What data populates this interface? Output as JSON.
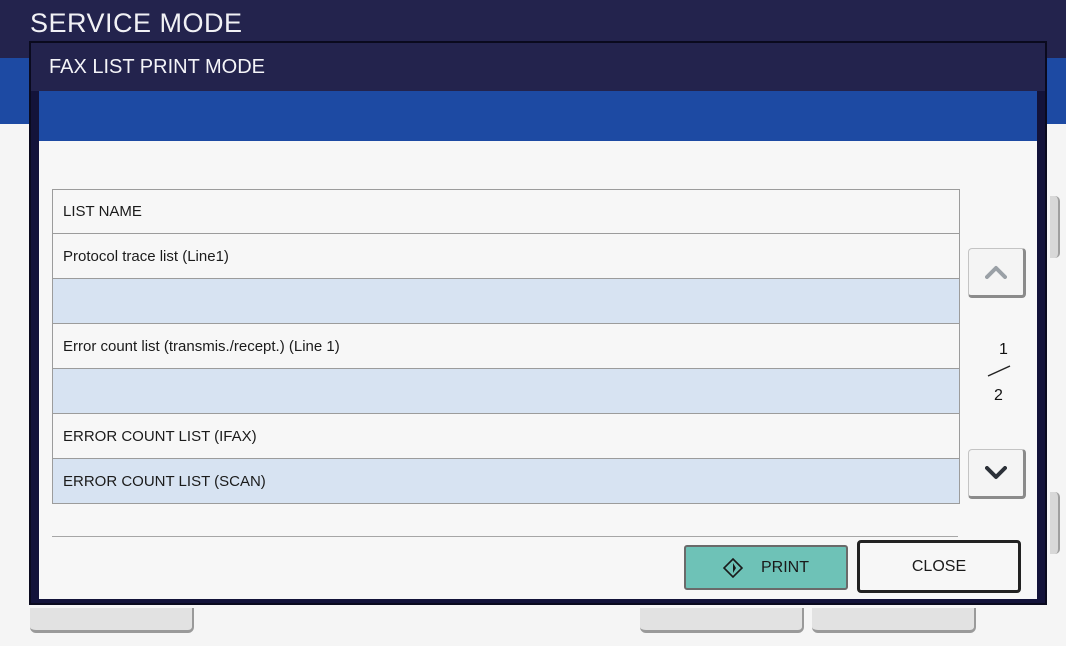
{
  "background": {
    "title": "SERVICE MODE"
  },
  "dialog": {
    "title": "FAX LIST PRINT MODE",
    "table": {
      "header": "LIST NAME",
      "rows": [
        "Protocol trace list (Line1)",
        "",
        "Error count list (transmis./recept.) (Line 1)",
        "",
        "ERROR COUNT LIST (IFAX)",
        "ERROR COUNT LIST (SCAN)"
      ]
    },
    "pager": {
      "current": "1",
      "total": "2",
      "up_icon": "chevron-up-icon",
      "down_icon": "chevron-down-icon"
    },
    "buttons": {
      "print_label": "PRINT",
      "print_icon": "start-diamond-icon",
      "close_label": "CLOSE"
    }
  },
  "colors": {
    "header_navy": "#23234d",
    "band_blue": "#1d4aa3",
    "alt_row": "#d7e3f2",
    "print_teal": "#6ec2b7"
  }
}
